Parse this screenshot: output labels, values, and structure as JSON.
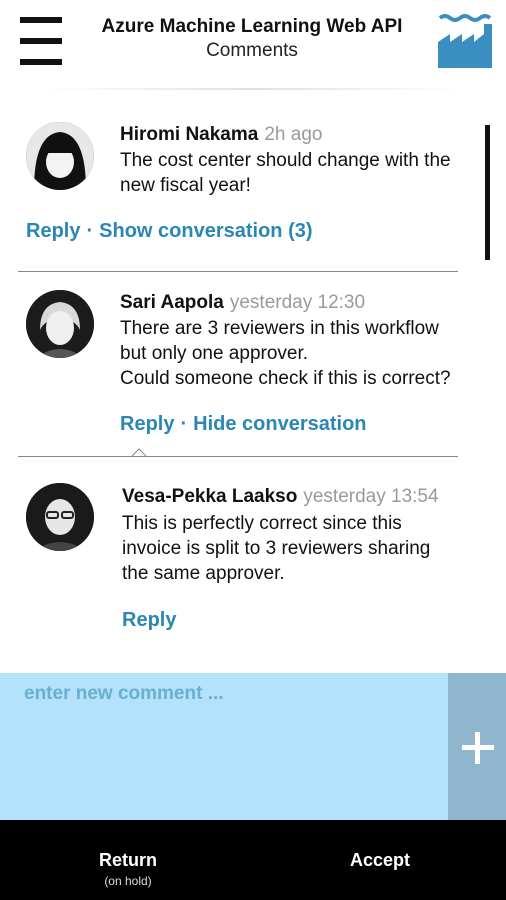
{
  "header": {
    "app_title": "Azure Machine Learning Web API",
    "page_title": "Comments",
    "menu_icon": "hamburger-menu-icon",
    "logo_icon": "factory-logo-icon"
  },
  "comments": [
    {
      "author": "Hiromi Nakama",
      "time": "2h ago",
      "lines": [
        "The cost center should change with the",
        "new fiscal year!"
      ],
      "reply_label": "Reply",
      "separator": "·",
      "conversation_label": "Show conversation (3)"
    },
    {
      "author": "Sari Aapola",
      "time": "yesterday 12:30",
      "lines": [
        "There are 3 reviewers in this workflow",
        "but only one approver.",
        "Could someone check if this is correct?"
      ],
      "reply_label": "Reply",
      "separator": "·",
      "conversation_label": "Hide conversation"
    },
    {
      "author": "Vesa-Pekka Laakso",
      "time": "yesterday 13:54",
      "lines": [
        "This is perfectly correct since this",
        "invoice is split to 3 reviewers sharing",
        "the same approver."
      ],
      "reply_label": "Reply"
    }
  ],
  "compose": {
    "placeholder": "enter new comment ...",
    "add_icon": "plus-icon"
  },
  "bottom_bar": {
    "return_label": "Return",
    "return_sub": "(on hold)",
    "accept_label": "Accept"
  },
  "colors": {
    "accent": "#2a86b4",
    "compose_bg": "#b3e2fb",
    "add_button_bg": "#8fb6cd",
    "logo": "#3a8fc0",
    "bottom_bar": "#000000",
    "timestamp": "#9a9a9a"
  }
}
